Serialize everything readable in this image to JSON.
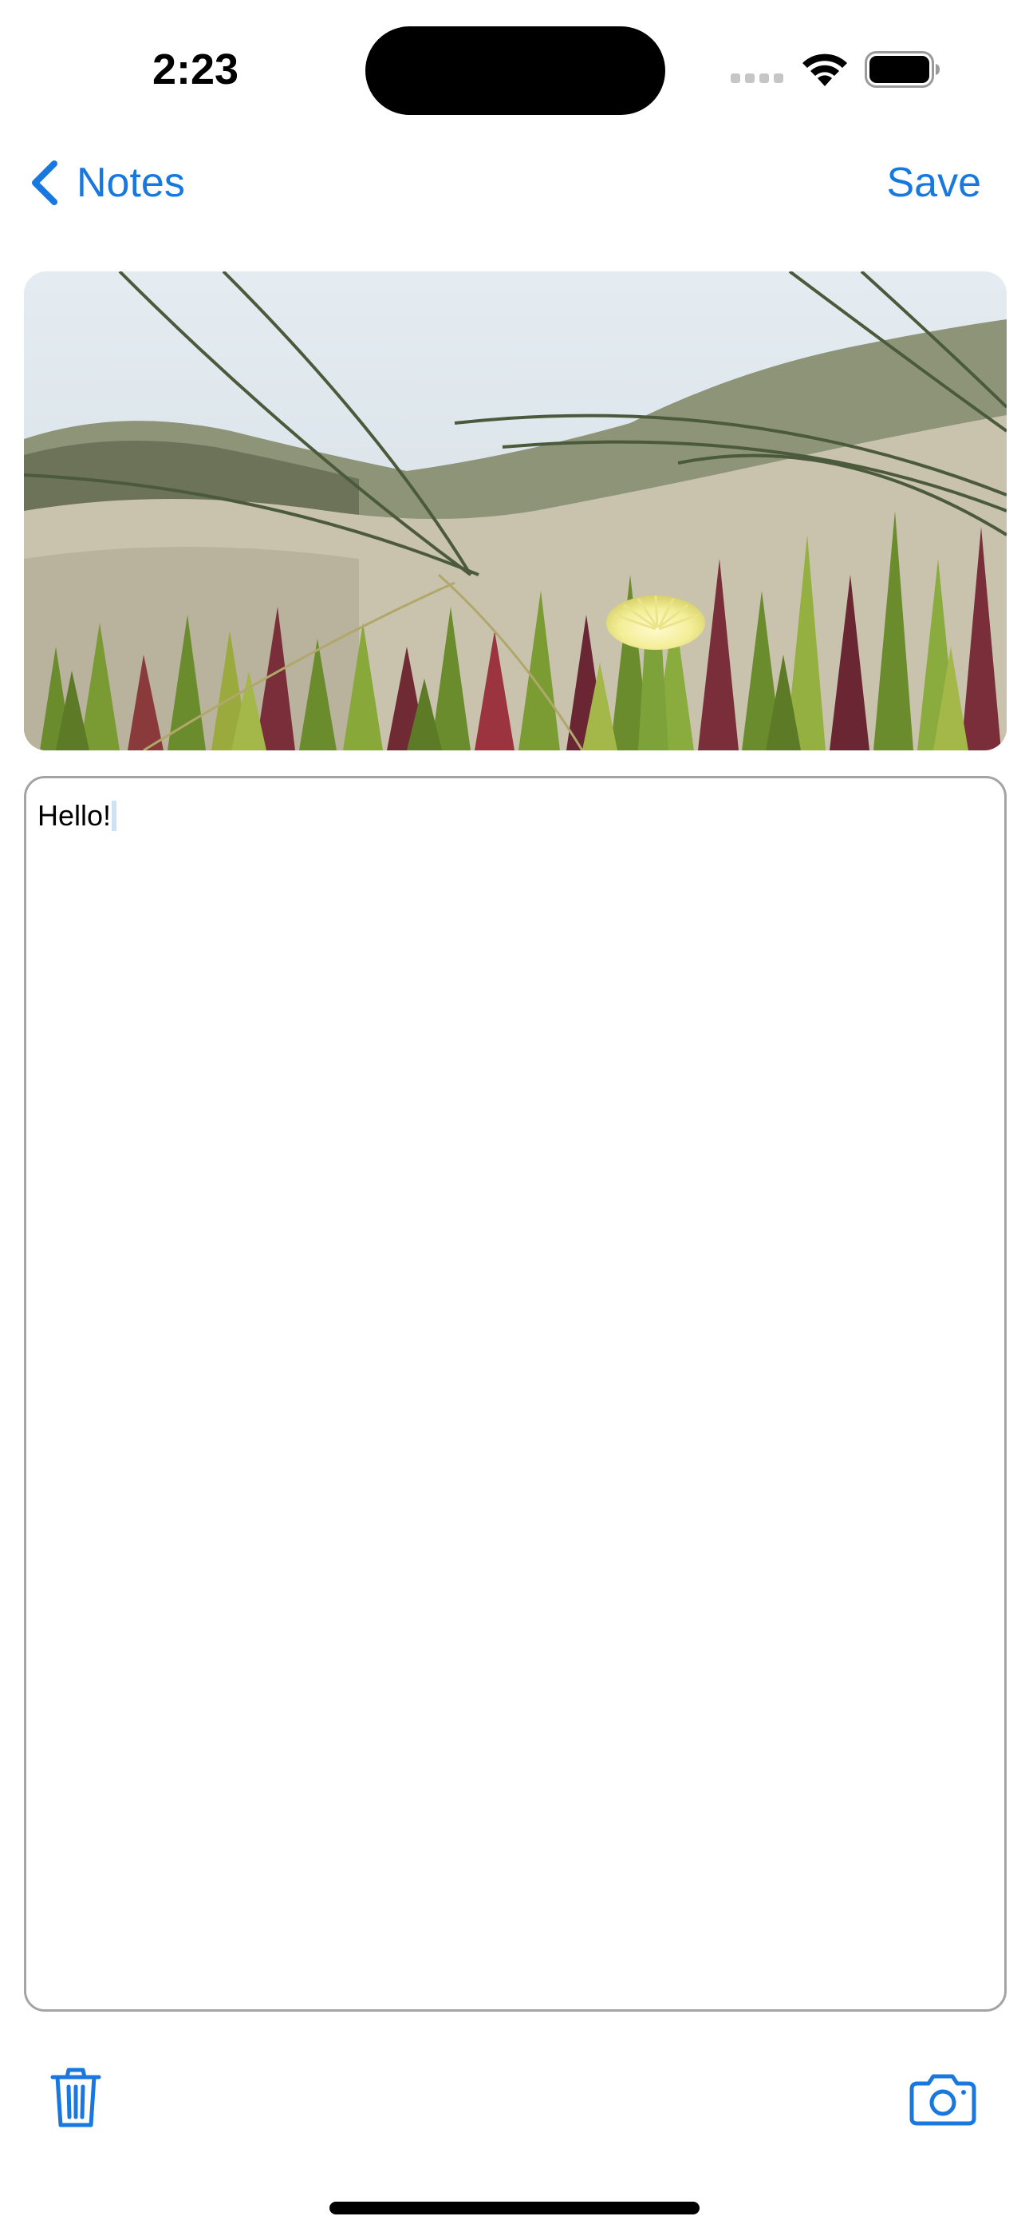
{
  "status_bar": {
    "time": "2:23",
    "signal_icon": "signal-bars-icon",
    "wifi_icon": "wifi-icon",
    "battery_icon": "battery-full-icon"
  },
  "nav_bar": {
    "back_icon": "chevron-left-icon",
    "back_label": "Notes",
    "save_label": "Save"
  },
  "note": {
    "photo": "beach-dune-flower-photo",
    "text": "Hello!"
  },
  "toolbar": {
    "delete_icon": "trash-icon",
    "camera_icon": "camera-icon"
  },
  "colors": {
    "accent": "#1878e0",
    "border": "#a3a3a8"
  }
}
